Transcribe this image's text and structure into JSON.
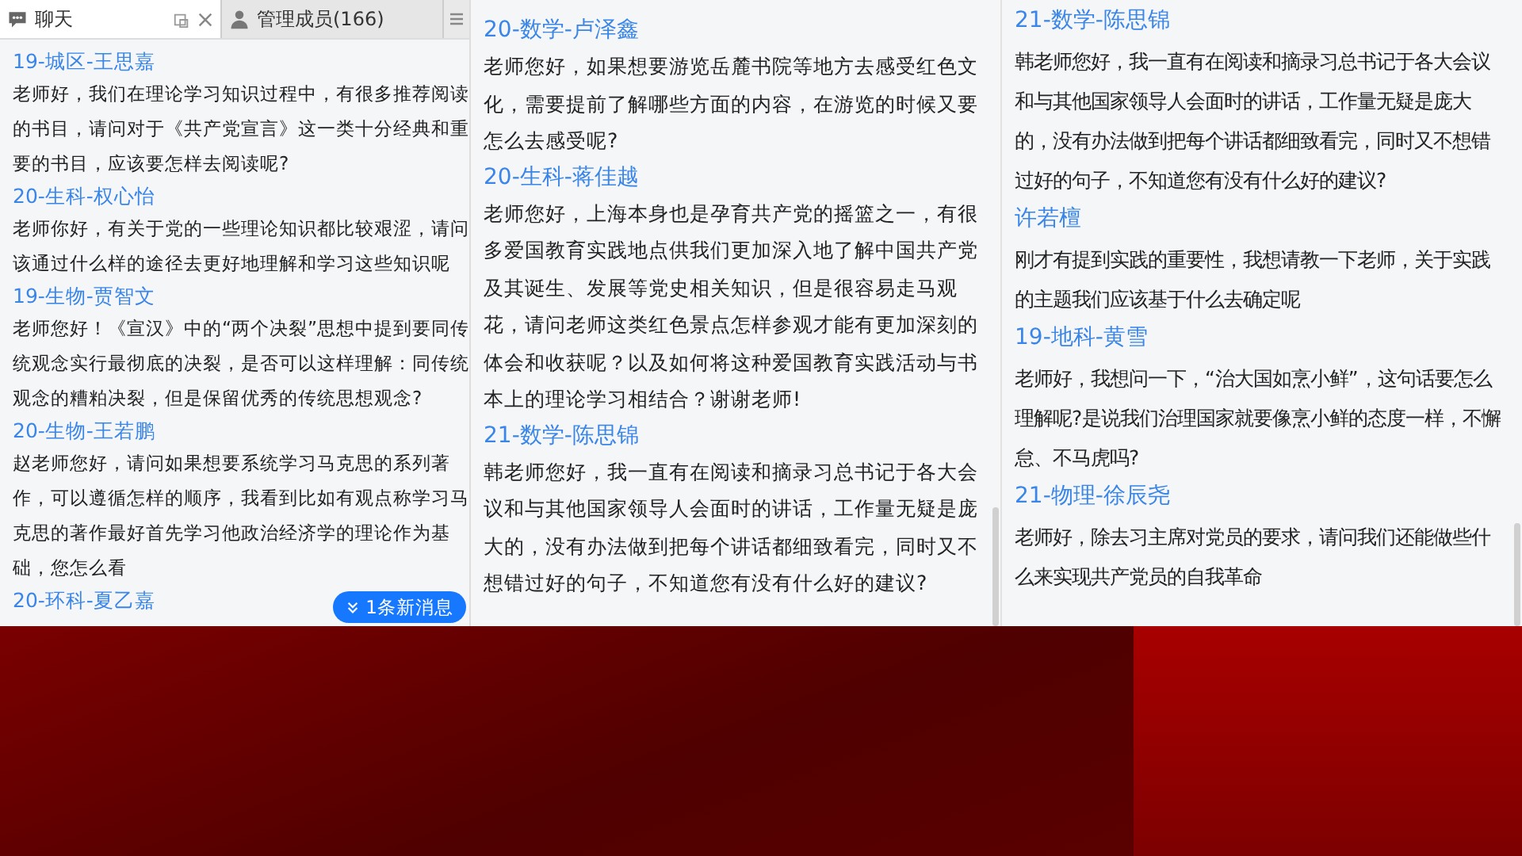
{
  "chat_window": {
    "tabs": [
      {
        "label": "聊天",
        "selected": true,
        "kind": "chat"
      },
      {
        "label": "管理成员(166)",
        "selected": false,
        "kind": "members"
      }
    ],
    "messages": [
      {
        "sender": "19-城区-王思嘉",
        "text": "老师好，我们在理论学习知识过程中，有很多推荐阅读的书目，请问对于《共产党宣言》这一类十分经典和重要的书目，应该要怎样去阅读呢?"
      },
      {
        "sender": "20-生科-权心怡",
        "text": "老师你好，有关于党的一些理论知识都比较艰涩，请问该通过什么样的途径去更好地理解和学习这些知识呢"
      },
      {
        "sender": "19-生物-贾智文",
        "text": "老师您好！《宣汉》中的“两个决裂”思想中提到要同传统观念实行最彻底的决裂，是否可以这样理解：同传统观念的糟粕决裂，但是保留优秀的传统思想观念?"
      },
      {
        "sender": "20-生物-王若鹏",
        "text": "赵老师您好，请问如果想要系统学习马克思的系列著作，可以遵循怎样的顺序，我看到比如有观点称学习马克思的著作最好首先学习他政治经济学的理论作为基础，您怎么看"
      },
      {
        "sender": "20-环科-夏乙嘉"
      }
    ],
    "new_message_badge": "1条新消息"
  },
  "middle_panel": {
    "messages": [
      {
        "sender": "20-数学-卢泽鑫",
        "text": "老师您好，如果想要游览岳麓书院等地方去感受红色文化，需要提前了解哪些方面的内容，在游览的时候又要怎么去感受呢?"
      },
      {
        "sender": "20-生科-蒋佳越",
        "text": "老师您好，上海本身也是孕育共产党的摇篮之一，有很多爱国教育实践地点供我们更加深入地了解中国共产党及其诞生、发展等党史相关知识，但是很容易走马观花，请问老师这类红色景点怎样参观才能有更加深刻的体会和收获呢？以及如何将这种爱国教育实践活动与书本上的理论学习相结合？谢谢老师!"
      },
      {
        "sender": "21-数学-陈思锦",
        "text": "韩老师您好，我一直有在阅读和摘录习总书记于各大会议和与其他国家领导人会面时的讲话，工作量无疑是庞大的，没有办法做到把每个讲话都细致看完，同时又不想错过好的句子，不知道您有没有什么好的建议?"
      }
    ]
  },
  "right_panel": {
    "messages": [
      {
        "sender": "21-数学-陈思锦",
        "text": "韩老师您好，我一直有在阅读和摘录习总书记于各大会议和与其他国家领导人会面时的讲话，工作量无疑是庞大的，没有办法做到把每个讲话都细致看完，同时又不想错过好的句子，不知道您有没有什么好的建议?"
      },
      {
        "sender": "许若檀",
        "text": "刚才有提到实践的重要性，我想请教一下老师，关于实践的主题我们应该基于什么去确定呢"
      },
      {
        "sender": "19-地科-黄雪",
        "text": "老师好，我想问一下，“治大国如烹小鲜”，这句话要怎么理解呢?是说我们治理国家就要像烹小鲜的态度一样，不懈怠、不马虎吗?"
      },
      {
        "sender": "21-物理-徐辰尧",
        "text": "老师好，除去习主席对党员的要求，请问我们还能做些什么来实现共产党员的自我革命"
      }
    ]
  }
}
